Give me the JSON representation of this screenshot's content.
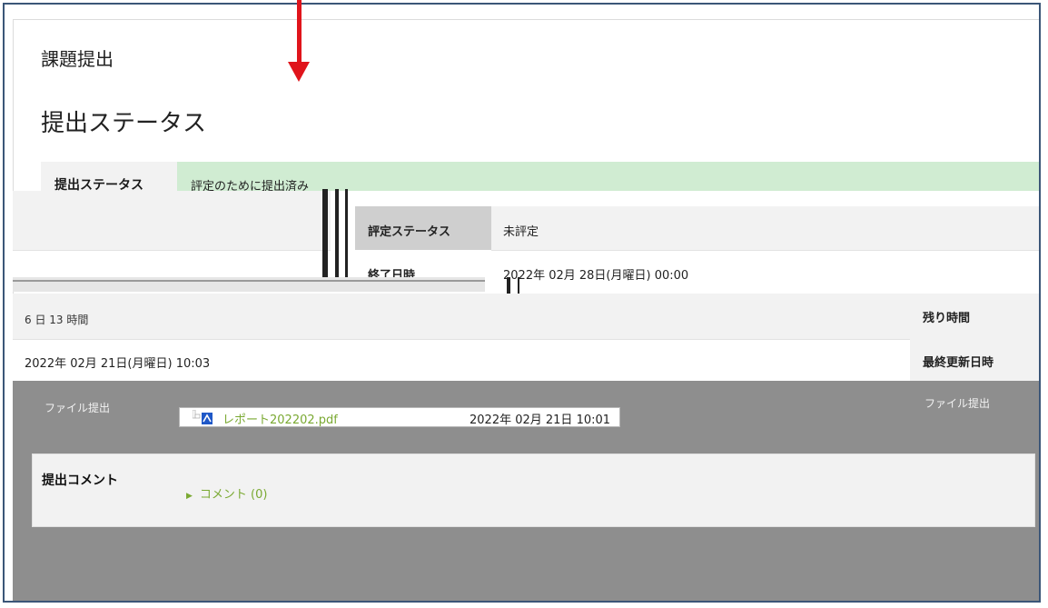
{
  "page": {
    "title": "課題提出",
    "subtitle": "提出ステータス"
  },
  "status_table": {
    "submission_status_label": "提出ステータス",
    "submission_status_value": "評定のために提出済み",
    "grading_status_label": "評定ステータス",
    "grading_status_value": "未評定",
    "due_date_label": "終了日時",
    "due_date_value": "2022年 02月 28日(月曜日) 00:00",
    "time_remaining_label": "残り時間",
    "time_remaining_value": "6 日 13 時間",
    "last_modified_label": "最終更新日時",
    "last_modified_value": "2022年 02月 21日(月曜日) 10:03",
    "file_submission_label": "ファイル提出",
    "file_submission_label_left": "ファイル提出"
  },
  "file": {
    "name": "レポート202202.pdf",
    "date": "2022年 02月 21日 10:01",
    "icon": "pdf-icon"
  },
  "comments": {
    "label": "提出コメント",
    "toggle": "コメント (0)",
    "icon": "triangle-right-icon"
  },
  "colors": {
    "accent_link": "#7aa932",
    "status_green": "#d0ecd2",
    "annotation_arrow": "#e0141b",
    "frame_border": "#3b5678"
  }
}
